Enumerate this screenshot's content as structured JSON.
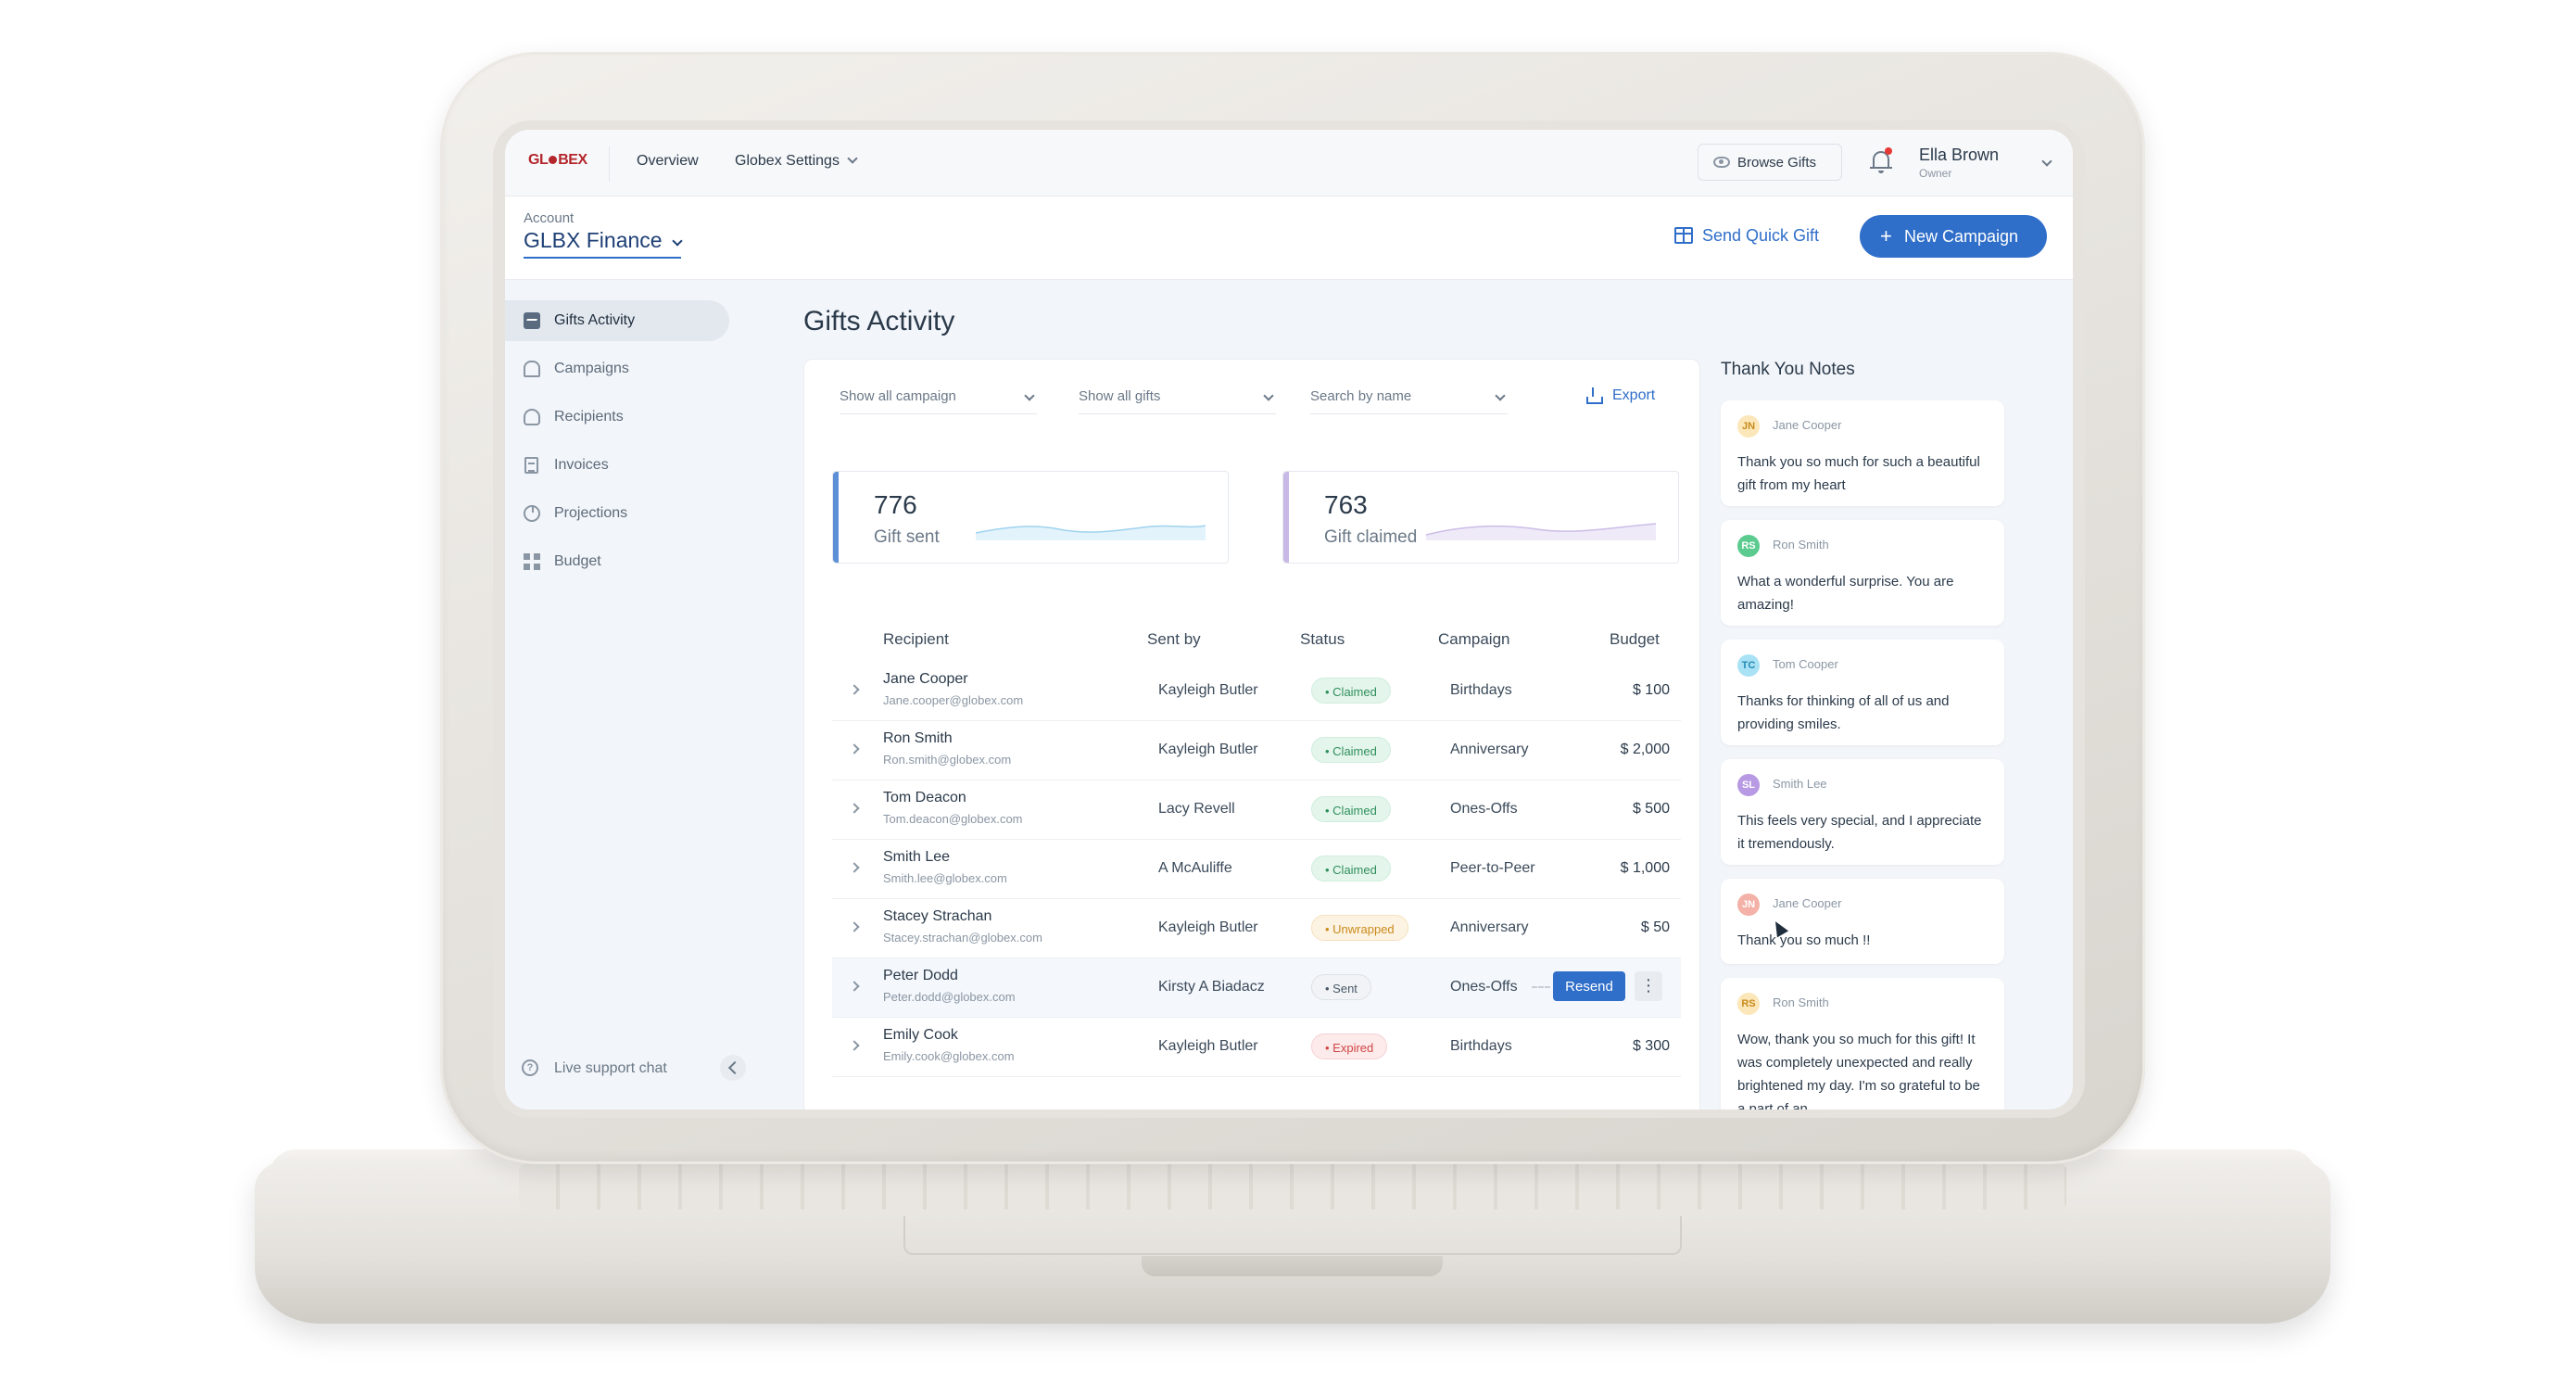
{
  "topnav": {
    "logo_text": "GL●BEX",
    "links": [
      "Overview",
      "Globex Settings"
    ],
    "browse_gifts": "Browse Gifts",
    "user": {
      "name": "Ella Brown",
      "role": "Owner"
    }
  },
  "account": {
    "label": "Account",
    "name": "GLBX Finance",
    "send_quick_gift": "Send Quick Gift",
    "new_campaign": "New Campaign"
  },
  "sidebar": {
    "items": [
      {
        "label": "Gifts Activity",
        "icon": "activity-icon",
        "active": true
      },
      {
        "label": "Campaigns",
        "icon": "campaign-icon",
        "active": false
      },
      {
        "label": "Recipients",
        "icon": "recipients-icon",
        "active": false
      },
      {
        "label": "Invoices",
        "icon": "invoice-icon",
        "active": false
      },
      {
        "label": "Projections",
        "icon": "projections-icon",
        "active": false
      },
      {
        "label": "Budget",
        "icon": "budget-icon",
        "active": false
      }
    ],
    "live_support": "Live support chat"
  },
  "main": {
    "title": "Gifts Activity",
    "filters": {
      "campaign": "Show all campaign",
      "gifts": "Show all gifts",
      "search": "Search by name",
      "export": "Export"
    },
    "stats": [
      {
        "value": "776",
        "label": "Gift sent",
        "color": "#5b8fd6"
      },
      {
        "value": "763",
        "label": "Gift claimed",
        "color": "#c7b8e6"
      }
    ],
    "columns": [
      "Recipient",
      "Sent by",
      "Status",
      "Campaign",
      "Budget"
    ],
    "rows": [
      {
        "name": "Jane Cooper",
        "email": "Jane.cooper@globex.com",
        "sent_by": "Kayleigh Butler",
        "status": "• Claimed",
        "campaign": "Birthdays",
        "budget": "$ 100"
      },
      {
        "name": "Ron Smith",
        "email": "Ron.smith@globex.com",
        "sent_by": "Kayleigh Butler",
        "status": "• Claimed",
        "campaign": "Anniversary",
        "budget": "$ 2,000"
      },
      {
        "name": "Tom Deacon",
        "email": "Tom.deacon@globex.com",
        "sent_by": "Lacy Revell",
        "status": "• Claimed",
        "campaign": "Ones-Offs",
        "budget": "$ 500"
      },
      {
        "name": "Smith Lee",
        "email": "Smith.lee@globex.com",
        "sent_by": "A McAuliffe",
        "status": "• Claimed",
        "campaign": "Peer-to-Peer",
        "budget": "$ 1,000"
      },
      {
        "name": "Stacey Strachan",
        "email": "Stacey.strachan@globex.com",
        "sent_by": "Kayleigh Butler",
        "status": "• Unwrapped",
        "campaign": "Anniversary",
        "budget": "$ 50"
      },
      {
        "name": "Peter Dodd",
        "email": "Peter.dodd@globex.com",
        "sent_by": "Kirsty A Biadacz",
        "status": "• Sent",
        "campaign": "Ones-Offs",
        "budget": "",
        "action": "Resend",
        "more": "⋮"
      },
      {
        "name": "Emily Cook",
        "email": "Emily.cook@globex.com",
        "sent_by": "Kayleigh Butler",
        "status": "• Expired",
        "campaign": "Birthdays",
        "budget": "$ 300"
      }
    ],
    "status_colors": {
      "claimed": "#2f8f5b",
      "unwrapped": "#c98a1d",
      "sent": "#4a5867",
      "expired": "#d04545"
    }
  },
  "notes": {
    "title": "Thank You Notes",
    "items": [
      {
        "initials": "JN",
        "name": "Jane Cooper",
        "text": "Thank you so much for such a beautiful gift from my heart"
      },
      {
        "initials": "RS",
        "name": "Ron Smith",
        "text": "What a wonderful surprise. You are amazing!"
      },
      {
        "initials": "TC",
        "name": "Tom Cooper",
        "text": "Thanks for thinking of all of us and providing smiles."
      },
      {
        "initials": "SL",
        "name": "Smith Lee",
        "text": "This feels very special, and I appreciate it tremendously."
      },
      {
        "initials": "JN",
        "name": "Jane Cooper",
        "text": "Thank you so much !!"
      },
      {
        "initials": "RS",
        "name": "Ron Smith",
        "text": "Wow, thank you so much for this gift! It was completely unexpected and really brightened my day. I'm so grateful to be a part of an"
      }
    ]
  },
  "colors": {
    "accent": "#2f6ec9",
    "brand": "#b3262b"
  }
}
